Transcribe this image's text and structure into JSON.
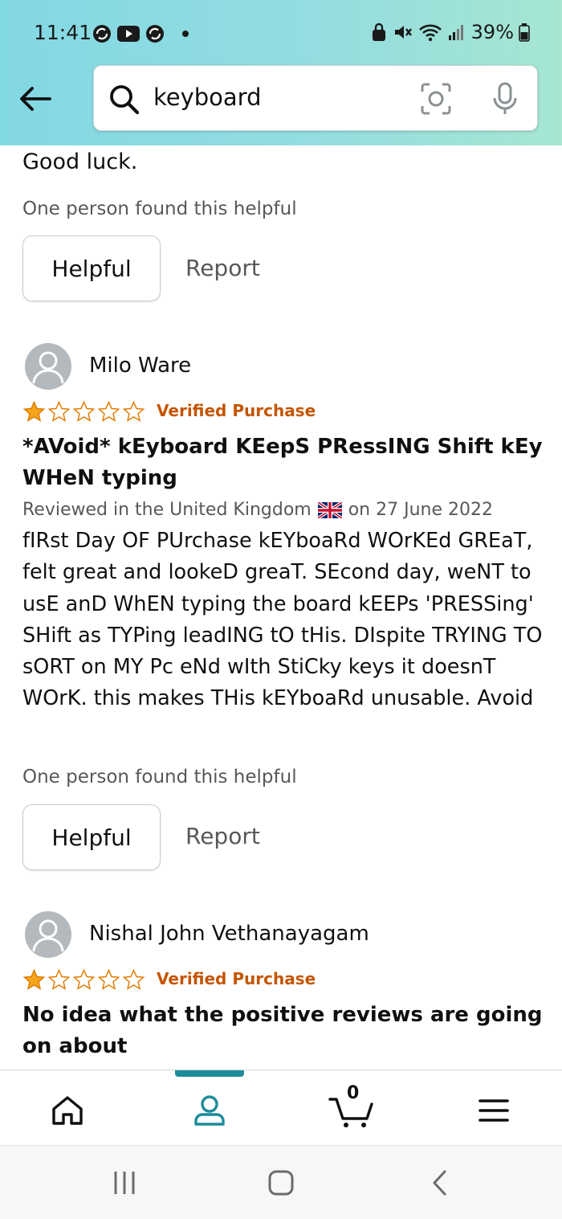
{
  "status_bar": {
    "time": "11:41",
    "battery": "39%",
    "left_icons": [
      "sync-icon",
      "youtube-icon",
      "sync-icon",
      "dot-icon"
    ],
    "right_icons": [
      "lock-icon",
      "mute-icon",
      "wifi-icon",
      "signal-icon",
      "battery-icon"
    ]
  },
  "search": {
    "query": "keyboard"
  },
  "content": {
    "prev_review_tail": "Good luck.",
    "prev_helpful_count": "One person found this helpful",
    "helpful_label": "Helpful",
    "report_label": "Report",
    "reviews": [
      {
        "name": "Milo Ware",
        "rating": 1,
        "max_rating": 5,
        "verified": "Verified Purchase",
        "title": "*AVoid* kEyboard KEepS PRessING Shift kEy WHeN typing",
        "meta_prefix": "Reviewed in the United Kingdom",
        "meta_suffix": "on 27 June 2022",
        "body": "fIRst Day OF PUrchase kEYboaRd WOrKEd GREaT, felt great and lookeD greaT. SEcond day, weNT to usE anD WhEN typing the board kEEPs 'PRESSing' SHift as TYPing leadING tO tHis. DIspite TRYING TO sORT on MY Pc eNd wIth StiCky keys it doesnT WOrK. this makes THis kEYboaRd unusable. Avoid",
        "helpful_count": "One person found this helpful"
      },
      {
        "name": "Nishal John Vethanayagam",
        "rating": 1,
        "max_rating": 5,
        "verified": "Verified Purchase",
        "title": "No idea what the positive reviews are going on about"
      }
    ]
  },
  "bottom_nav": {
    "items": [
      "home-icon",
      "account-icon",
      "cart-icon",
      "menu-icon"
    ],
    "active_index": 1,
    "cart_count": "0"
  },
  "colors": {
    "header_gradient_start": "#82d8e3",
    "header_gradient_end": "#a6e6d2",
    "accent": "#1d8b9a",
    "verified": "#c45500",
    "star": "#f3a51c",
    "star_outline": "#e07b00",
    "secondary_text": "#565959"
  }
}
